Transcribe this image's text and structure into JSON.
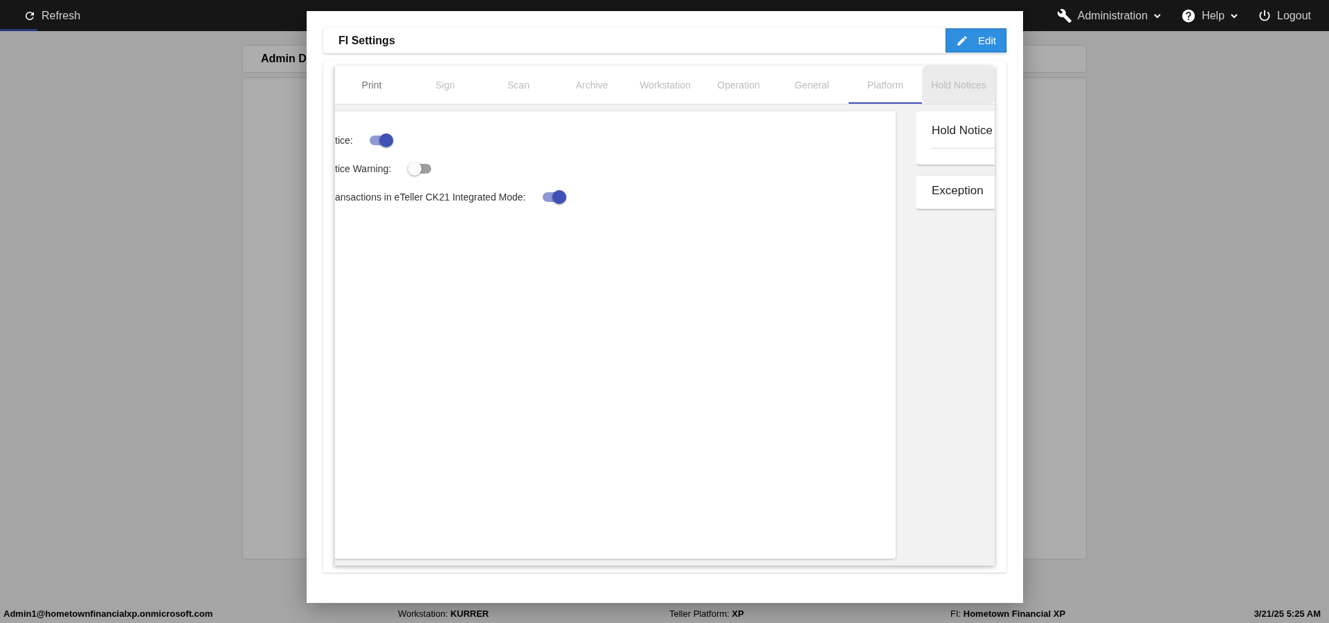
{
  "top_bar": {
    "refresh": "Refresh",
    "menu": [
      {
        "kind": "admin",
        "label": "Administration"
      },
      {
        "kind": "help",
        "label": "Help"
      },
      {
        "kind": "logout",
        "label": "Logout"
      }
    ]
  },
  "background": {
    "panel_title": "Admin D"
  },
  "modal": {
    "title": "FI Settings",
    "edit_button": "Edit",
    "tabs": [
      {
        "label": "Print",
        "selected": false,
        "focused": true,
        "hovered": false
      },
      {
        "label": "Sign",
        "selected": false,
        "focused": false,
        "hovered": false
      },
      {
        "label": "Scan",
        "selected": false,
        "focused": false,
        "hovered": false
      },
      {
        "label": "Archive",
        "selected": false,
        "focused": false,
        "hovered": false
      },
      {
        "label": "Workstation",
        "selected": false,
        "focused": false,
        "hovered": false
      },
      {
        "label": "Operation",
        "selected": false,
        "focused": false,
        "hovered": false
      },
      {
        "label": "General",
        "selected": false,
        "focused": false,
        "hovered": false
      },
      {
        "label": "Platform",
        "selected": true,
        "focused": false,
        "hovered": false
      },
      {
        "label": "Hold Notices",
        "selected": false,
        "focused": false,
        "hovered": true
      }
    ],
    "settings": [
      {
        "label": "tice:",
        "on": true
      },
      {
        "label": "tice Warning:",
        "on": false
      },
      {
        "label": "ansactions in eTeller CK21 Integrated Mode:",
        "on": true
      }
    ],
    "side_cards": [
      {
        "title": "Hold Notice",
        "expanded": true
      },
      {
        "title": "Exception",
        "expanded": false
      }
    ]
  },
  "status_bar": {
    "user": "Admin1@hometownfinancialxp.onmicrosoft.com",
    "fields": [
      {
        "label": "Workstation:",
        "value": "KURRER"
      },
      {
        "label": "Teller Platform:",
        "value": "XP"
      },
      {
        "label": "FI:",
        "value": "Hometown Financial XP"
      }
    ],
    "datetime": "3/21/25 5:25 AM"
  }
}
